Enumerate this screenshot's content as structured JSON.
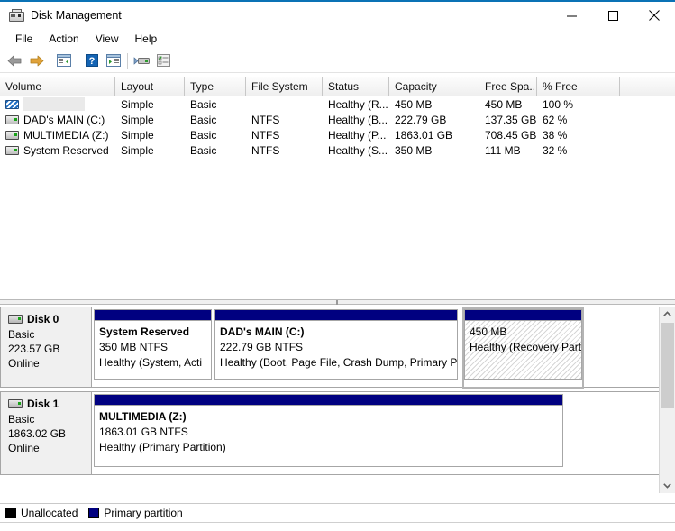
{
  "window": {
    "title": "Disk Management",
    "icon": "disk-management-icon",
    "buttons": {
      "minimize": "–",
      "maximize": "□",
      "close": "✕"
    }
  },
  "menubar": {
    "items": [
      "File",
      "Action",
      "View",
      "Help"
    ]
  },
  "toolbar": {
    "items": [
      {
        "name": "back-icon",
        "label": "Back"
      },
      {
        "name": "forward-icon",
        "label": "Forward"
      },
      {
        "name": "show-hide-console-tree-icon",
        "label": "Show/Hide Console Tree"
      },
      {
        "name": "help-icon",
        "label": "Help"
      },
      {
        "name": "show-hide-action-pane-icon",
        "label": "Show/Hide Action Pane"
      },
      {
        "name": "rescan-disks-icon",
        "label": "Rescan Disks"
      },
      {
        "name": "properties-icon",
        "label": "Properties"
      }
    ]
  },
  "volume_list": {
    "columns": [
      "Volume",
      "Layout",
      "Type",
      "File System",
      "Status",
      "Capacity",
      "Free Spa...",
      "% Free"
    ],
    "rows": [
      {
        "volume": "",
        "icon": "hatched-partition-icon",
        "selected": true,
        "layout": "Simple",
        "type": "Basic",
        "file_system": "",
        "status": "Healthy (R...",
        "capacity": "450 MB",
        "free_space": "450 MB",
        "percent_free": "100 %"
      },
      {
        "volume": "DAD's MAIN (C:)",
        "icon": "volume-icon",
        "selected": false,
        "layout": "Simple",
        "type": "Basic",
        "file_system": "NTFS",
        "status": "Healthy (B...",
        "capacity": "222.79 GB",
        "free_space": "137.35 GB",
        "percent_free": "62 %"
      },
      {
        "volume": "MULTIMEDIA (Z:)",
        "icon": "volume-icon",
        "selected": false,
        "layout": "Simple",
        "type": "Basic",
        "file_system": "NTFS",
        "status": "Healthy (P...",
        "capacity": "1863.01 GB",
        "free_space": "708.45 GB",
        "percent_free": "38 %"
      },
      {
        "volume": "System Reserved",
        "icon": "volume-icon",
        "selected": false,
        "layout": "Simple",
        "type": "Basic",
        "file_system": "NTFS",
        "status": "Healthy (S...",
        "capacity": "350 MB",
        "free_space": "111 MB",
        "percent_free": "32 %"
      }
    ]
  },
  "disks": [
    {
      "name": "Disk 0",
      "type": "Basic",
      "size": "223.57 GB",
      "status": "Online",
      "partitions": [
        {
          "name": "System Reserved",
          "size_fs": "350 MB NTFS",
          "health": "Healthy (System, Acti",
          "style": "primary",
          "selected": false
        },
        {
          "name": "DAD's MAIN  (C:)",
          "size_fs": "222.79 GB NTFS",
          "health": "Healthy (Boot, Page File, Crash Dump, Primary P",
          "style": "primary",
          "selected": false
        },
        {
          "name": "",
          "size_fs": "450 MB",
          "health": "Healthy (Recovery Part",
          "style": "unallocated",
          "selected": true
        }
      ]
    },
    {
      "name": "Disk 1",
      "type": "Basic",
      "size": "1863.02 GB",
      "status": "Online",
      "partitions": [
        {
          "name": "MULTIMEDIA  (Z:)",
          "size_fs": "1863.01 GB NTFS",
          "health": "Healthy (Primary Partition)",
          "style": "primary",
          "selected": false
        }
      ]
    }
  ],
  "scrollbar": {
    "up": "▲",
    "down": "▼"
  },
  "legend": {
    "items": [
      {
        "label": "Unallocated",
        "color": "#000000"
      },
      {
        "label": "Primary partition",
        "color": "#000080"
      }
    ]
  }
}
